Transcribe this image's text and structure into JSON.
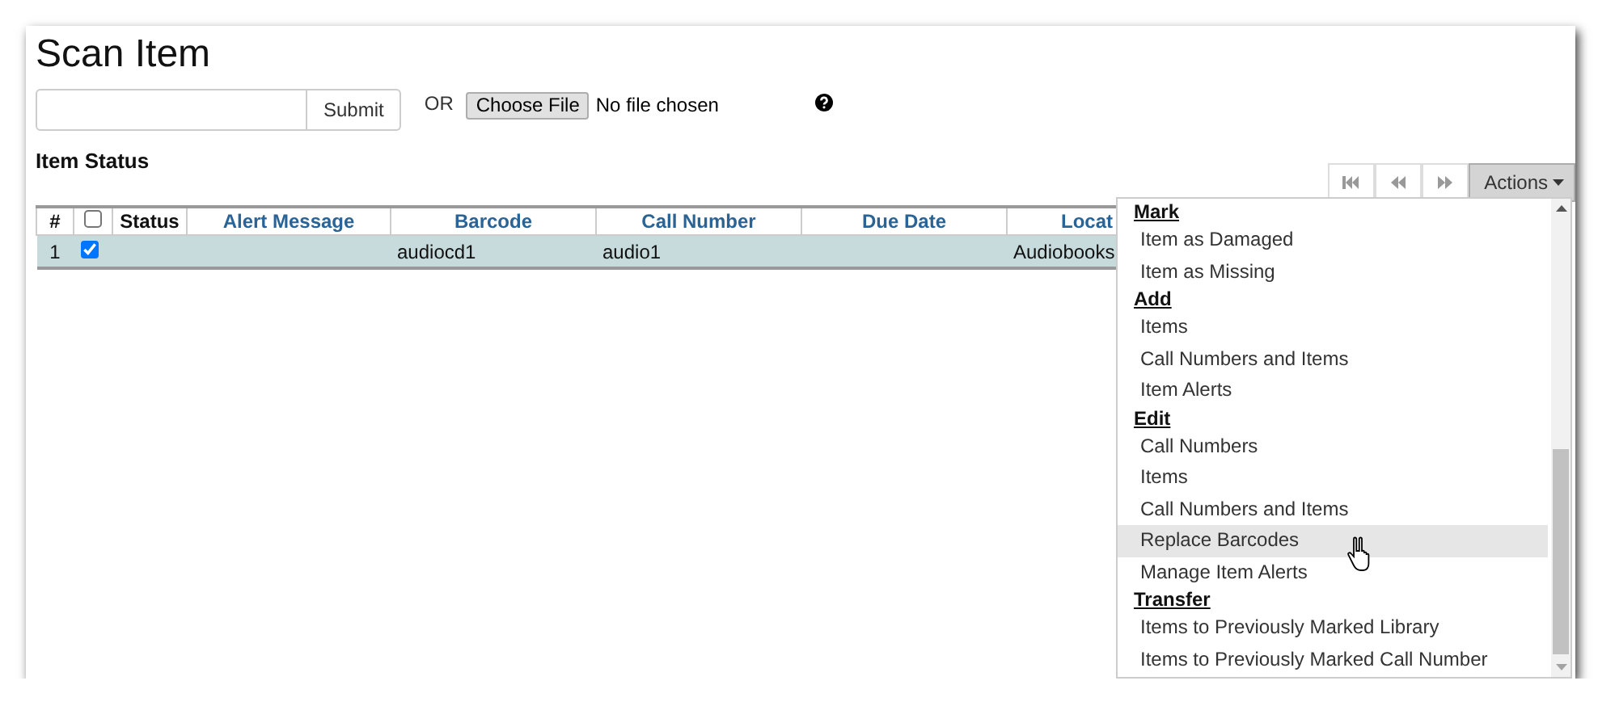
{
  "title": "Scan Item",
  "scan": {
    "submit": "Submit",
    "or": "OR",
    "choose_file": "Choose File",
    "file_status": "No file chosen"
  },
  "section_title": "Item Status",
  "pager": {
    "actions": "Actions"
  },
  "table": {
    "header_checked": false,
    "columns": [
      "#",
      "Status",
      "Alert Message",
      "Barcode",
      "Call Number",
      "Due Date",
      "Locat"
    ],
    "rows": [
      {
        "selected": true,
        "checked": true,
        "number": "1",
        "barcode": "audiocd1",
        "call_number": "audio1",
        "location": "Audiobooks"
      }
    ]
  },
  "menu": {
    "groups": [
      {
        "heading": "Mark",
        "items": [
          {
            "label": "Item as Damaged",
            "hovered": false
          },
          {
            "label": "Item as Missing",
            "hovered": false
          }
        ]
      },
      {
        "heading": "Add",
        "items": [
          {
            "label": "Items",
            "hovered": false
          },
          {
            "label": "Call Numbers and Items",
            "hovered": false
          },
          {
            "label": "Item Alerts",
            "hovered": false
          }
        ]
      },
      {
        "heading": "Edit",
        "items": [
          {
            "label": "Call Numbers",
            "hovered": false
          },
          {
            "label": "Items",
            "hovered": false
          },
          {
            "label": "Call Numbers and Items",
            "hovered": false
          },
          {
            "label": "Replace Barcodes",
            "hovered": true
          },
          {
            "label": "Manage Item Alerts",
            "hovered": false
          }
        ]
      },
      {
        "heading": "Transfer",
        "items": [
          {
            "label": "Items to Previously Marked Library",
            "hovered": false
          },
          {
            "label": "Items to Previously Marked Call Number",
            "hovered": false
          }
        ]
      }
    ]
  }
}
